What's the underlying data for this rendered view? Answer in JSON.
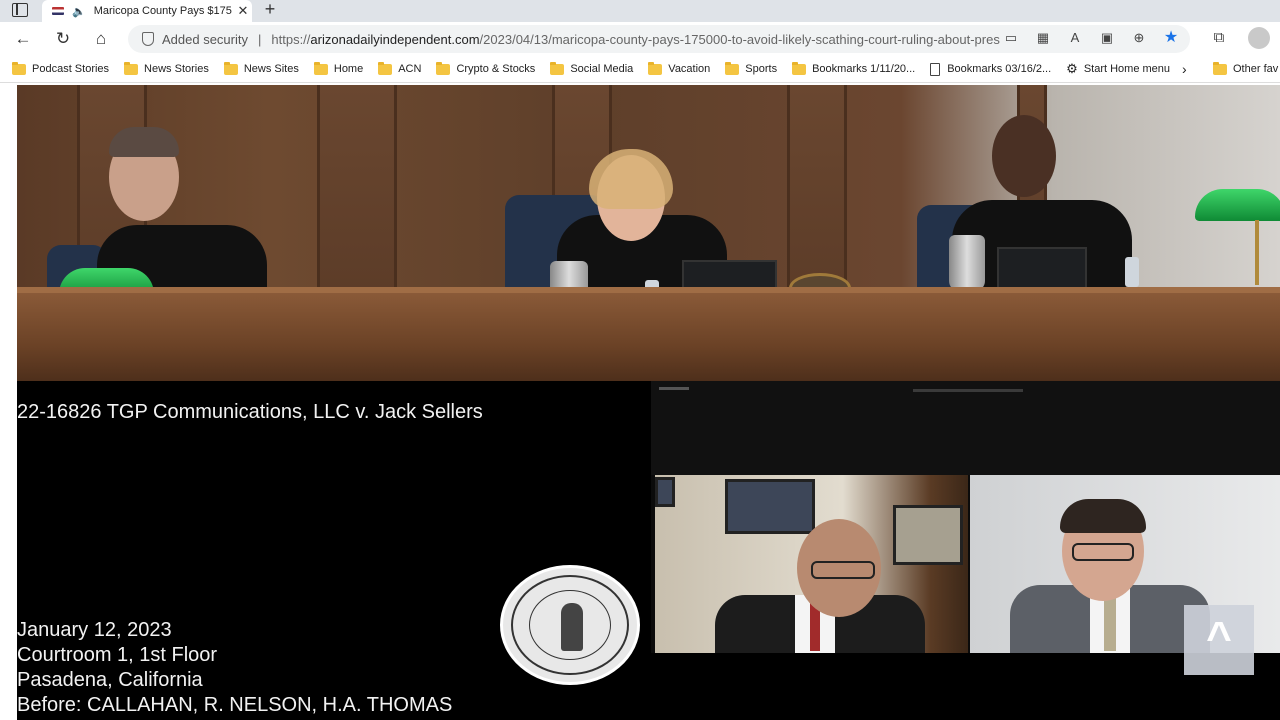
{
  "browser": {
    "tab": {
      "title": "Maricopa County Pays $175",
      "close": "✕"
    },
    "new_tab": "+",
    "address_bar": {
      "security_text": "Added security",
      "separator": "|",
      "url_prefix": "https://",
      "url_domain": "arizonadailyindependent.com",
      "url_path": "/2023/04/13/maricopa-county-pays-175000-to-avoid-likely-scathing-court-ruling-about-pres..."
    },
    "bookmarks": [
      {
        "label": "Podcast Stories",
        "icon": "folder-icon"
      },
      {
        "label": "News Stories",
        "icon": "folder-icon"
      },
      {
        "label": "News Sites",
        "icon": "folder-icon"
      },
      {
        "label": "Home",
        "icon": "folder-icon"
      },
      {
        "label": "ACN",
        "icon": "folder-icon"
      },
      {
        "label": "Crypto & Stocks",
        "icon": "folder-icon"
      },
      {
        "label": "Social Media",
        "icon": "folder-icon"
      },
      {
        "label": "Vacation",
        "icon": "folder-icon"
      },
      {
        "label": "Sports",
        "icon": "folder-icon"
      },
      {
        "label": "Bookmarks 1/11/20...",
        "icon": "folder-icon"
      },
      {
        "label": "Bookmarks 03/16/2...",
        "icon": "page-icon"
      },
      {
        "label": "Start Home menu",
        "icon": "gear-icon"
      }
    ],
    "bookmarks_overflow": "›",
    "other_favorites": "Other fav"
  },
  "video": {
    "case_title": "22-16826 TGP Communications, LLC v. Jack Sellers",
    "date": "January 12, 2023",
    "courtroom": "Courtroom 1, 1st Floor",
    "location": "Pasadena, California",
    "panel": "Before: CALLAHAN, R. NELSON, H.A. THOMAS"
  },
  "scroll_top_icon": "^"
}
